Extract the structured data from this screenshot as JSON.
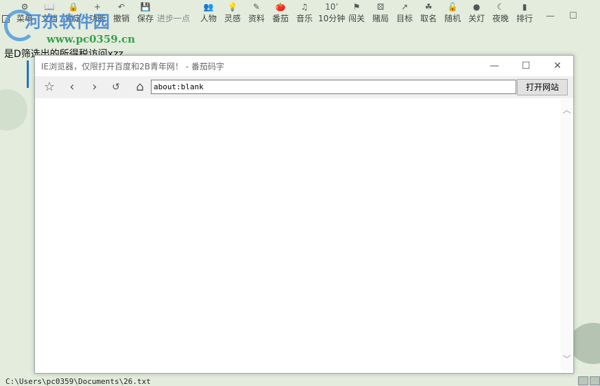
{
  "toolbar": {
    "items": [
      {
        "icon": "⚙",
        "label": "菜单"
      },
      {
        "icon": "📖",
        "label": "文档"
      },
      {
        "icon": "🔒",
        "label": "锁定"
      },
      {
        "icon": "+",
        "label": "功能"
      },
      {
        "icon": "↶",
        "label": "撤销"
      },
      {
        "icon": "💾",
        "label": "保存"
      },
      {
        "icon": "",
        "label": "进步一点"
      },
      {
        "icon": "👥",
        "label": "人物"
      },
      {
        "icon": "💡",
        "label": "灵感"
      },
      {
        "icon": "✎",
        "label": "资料"
      },
      {
        "icon": "🍅",
        "label": "番茄"
      },
      {
        "icon": "♫",
        "label": "音乐"
      },
      {
        "icon": "10’",
        "label": "10分钟"
      },
      {
        "icon": "⚑",
        "label": "闯关"
      },
      {
        "icon": "⚄",
        "label": "赌局"
      },
      {
        "icon": "↗",
        "label": "目标"
      },
      {
        "icon": "☘",
        "label": "取名"
      },
      {
        "icon": "🔓",
        "label": "随机"
      },
      {
        "icon": "●",
        "label": "关灯"
      },
      {
        "icon": "☾",
        "label": "夜晚"
      },
      {
        "icon": "▮",
        "label": "排行"
      }
    ],
    "minimize": "—",
    "maximize": "☐"
  },
  "watermark": {
    "title": "河东软件园",
    "url": "www.pc0359.cn"
  },
  "document": {
    "text": "是D筛选出的所得税访问xzz",
    "status_path": "C:\\Users\\pc0359\\Documents\\26.txt"
  },
  "dialog": {
    "title": "IE浏览器，仅限打开百度和2B青年网！ - 番茄码字",
    "minimize": "—",
    "maximize": "☐",
    "close": "✕",
    "address": "about:blank",
    "open_button": "打开网站"
  }
}
